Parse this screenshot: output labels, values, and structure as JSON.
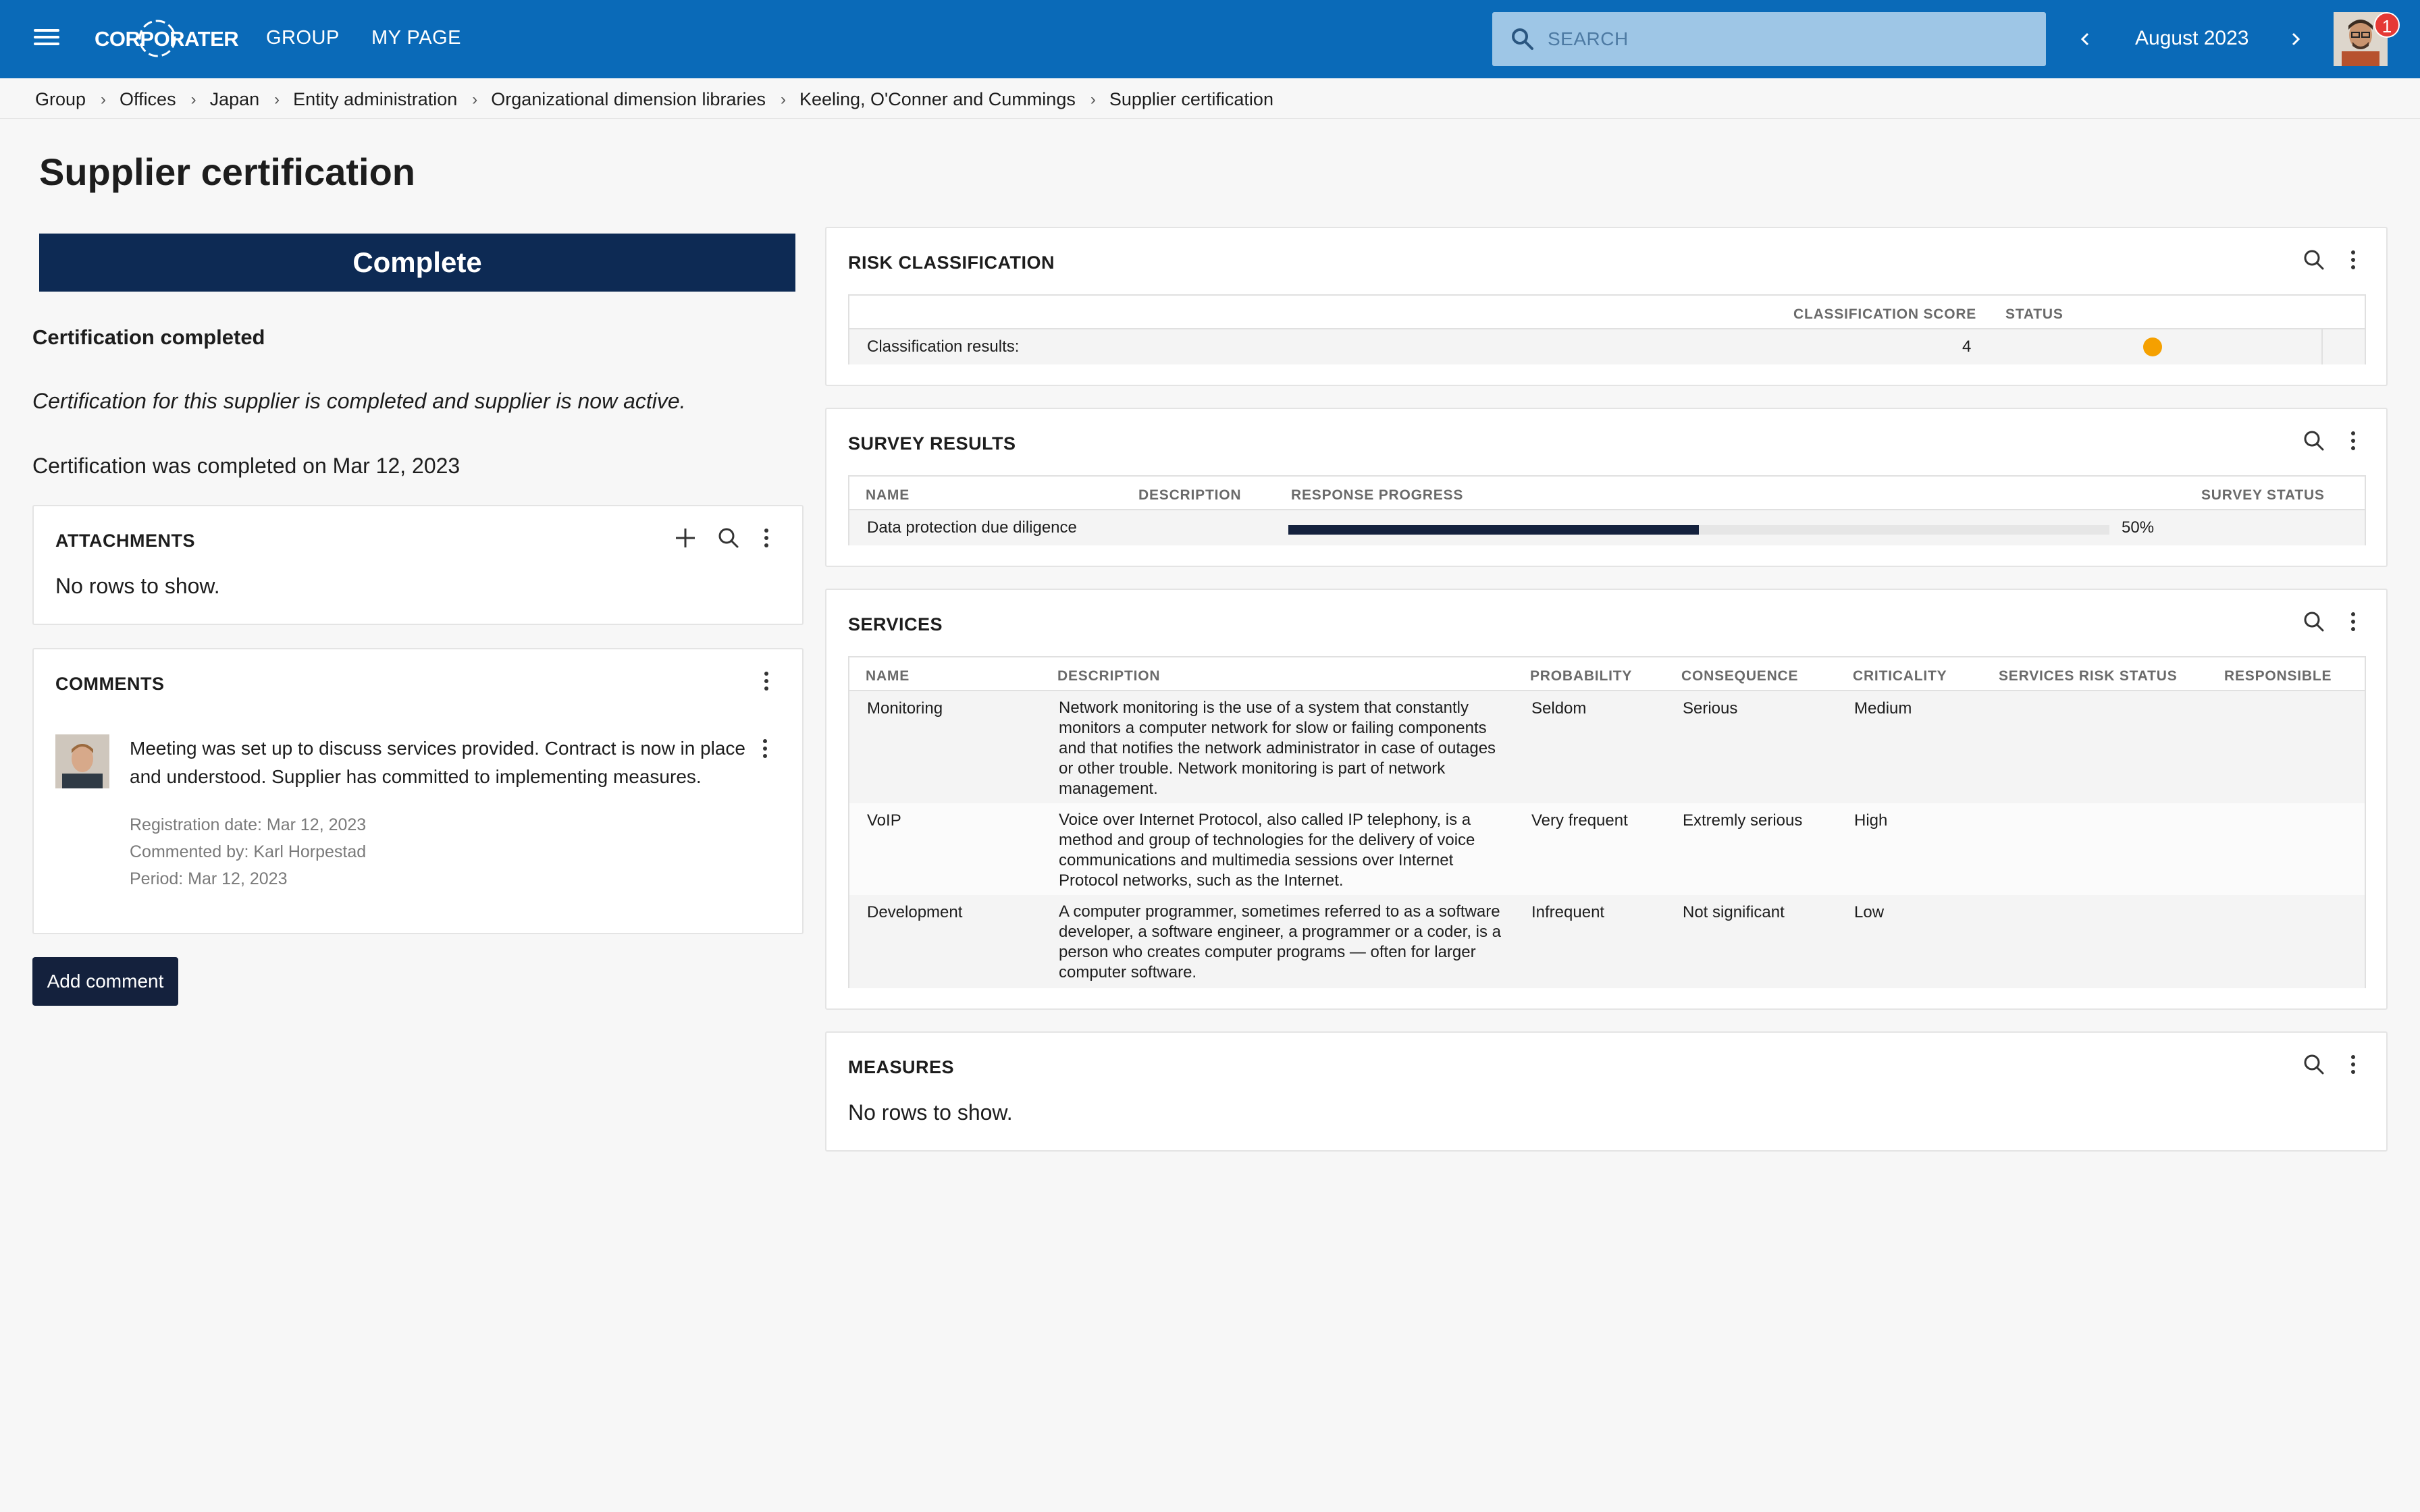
{
  "topbar": {
    "logo_text": "CORPORATER",
    "nav": [
      "GROUP",
      "MY PAGE"
    ],
    "search_placeholder": "SEARCH",
    "period": "August 2023",
    "notifications": "1",
    "brand_color": "#0a6ab8"
  },
  "breadcrumb": [
    "Group",
    "Offices",
    "Japan",
    "Entity administration",
    "Organizational dimension libraries",
    "Keeling, O'Conner and Cummings",
    "Supplier certification"
  ],
  "page": {
    "title": "Supplier certification",
    "status": "Complete",
    "status_color": "#0d2a54",
    "cert_heading": "Certification completed",
    "cert_message": "Certification for this supplier is completed and supplier is now active.",
    "cert_date": "Certification was completed on Mar 12, 2023"
  },
  "attachments": {
    "title": "ATTACHMENTS",
    "empty": "No rows to show."
  },
  "comments": {
    "title": "COMMENTS",
    "items": [
      {
        "text": "Meeting was set up to discuss services provided. Contract is now in place and understood. Supplier has committed to implementing measures.",
        "registration": "Registration date: Mar 12, 2023",
        "commented_by": "Commented by: Karl Horpestad",
        "period": "Period: Mar 12, 2023"
      }
    ],
    "add_label": "Add comment"
  },
  "risk": {
    "title": "RISK CLASSIFICATION",
    "columns": [
      "CLASSIFICATION SCORE",
      "STATUS"
    ],
    "row_label": "Classification results:",
    "score": "4",
    "status_color": "#f5a000"
  },
  "survey": {
    "title": "SURVEY RESULTS",
    "columns": [
      "NAME",
      "DESCRIPTION",
      "RESPONSE PROGRESS",
      "SURVEY STATUS"
    ],
    "rows": [
      {
        "name": "Data protection due diligence",
        "description": "",
        "progress": 0.5,
        "progress_label": "50%",
        "status": ""
      }
    ]
  },
  "services": {
    "title": "SERVICES",
    "columns": [
      "NAME",
      "DESCRIPTION",
      "PROBABILITY",
      "CONSEQUENCE",
      "CRITICALITY",
      "SERVICES RISK STATUS",
      "RESPONSIBLE"
    ],
    "rows": [
      {
        "name": "Monitoring",
        "description": "Network monitoring is the use of a system that constantly monitors a computer network for slow or failing components and that notifies the network administrator in case of outages or other trouble. Network monitoring is part of network management.",
        "probability": "Seldom",
        "consequence": "Serious",
        "criticality": "Medium"
      },
      {
        "name": "VoIP",
        "description": "Voice over Internet Protocol, also called IP telephony, is a method and group of technologies for the delivery of voice communications and multimedia sessions over Internet Protocol networks, such as the Internet.",
        "probability": "Very frequent",
        "consequence": "Extremly serious",
        "criticality": "High"
      },
      {
        "name": "Development",
        "description": "A computer programmer, sometimes referred to as a software developer, a software engineer, a programmer or a coder, is a person who creates computer programs — often for larger computer software.",
        "probability": "Infrequent",
        "consequence": "Not significant",
        "criticality": "Low"
      }
    ]
  },
  "measures": {
    "title": "MEASURES",
    "empty": "No rows to show."
  }
}
